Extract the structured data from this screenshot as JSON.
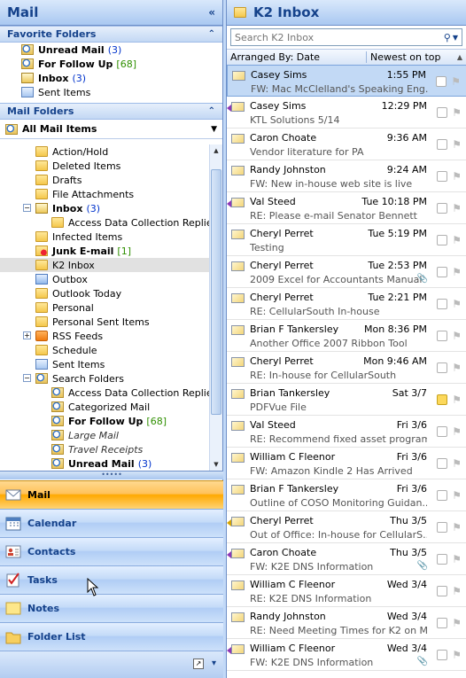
{
  "left": {
    "title": "Mail",
    "favorites": {
      "header": "Favorite Folders",
      "items": [
        {
          "label": "Unread Mail",
          "count": "(3)",
          "type": "search",
          "bold": true
        },
        {
          "label": "For Follow Up",
          "count": "[68]",
          "type": "search",
          "bold": true
        },
        {
          "label": "Inbox",
          "count": "(3)",
          "type": "inbox",
          "bold": true
        },
        {
          "label": "Sent Items",
          "count": "",
          "type": "sent",
          "bold": false
        }
      ]
    },
    "mail_folders": {
      "header": "Mail Folders",
      "all_items": "All Mail Items",
      "tree": [
        {
          "label": "Action/Hold",
          "indent": 40,
          "icon": "folder"
        },
        {
          "label": "Deleted Items",
          "indent": 40,
          "icon": "folder"
        },
        {
          "label": "Drafts",
          "indent": 40,
          "icon": "folder"
        },
        {
          "label": "File Attachments",
          "indent": 40,
          "icon": "folder"
        },
        {
          "label": "Inbox",
          "indent": 40,
          "icon": "inbox",
          "bold": true,
          "count": "(3)",
          "countColor": "blue",
          "exp": "−"
        },
        {
          "label": "Access Data Collection Replies",
          "indent": 58,
          "icon": "folder"
        },
        {
          "label": "Infected Items",
          "indent": 40,
          "icon": "folder"
        },
        {
          "label": "Junk E-mail",
          "indent": 40,
          "icon": "junk",
          "bold": true,
          "count": "[1]",
          "countColor": "green"
        },
        {
          "label": "K2 Inbox",
          "indent": 40,
          "icon": "folder",
          "sel": true
        },
        {
          "label": "Outbox",
          "indent": 40,
          "icon": "out"
        },
        {
          "label": "Outlook Today",
          "indent": 40,
          "icon": "folder"
        },
        {
          "label": "Personal",
          "indent": 40,
          "icon": "folder"
        },
        {
          "label": "Personal Sent Items",
          "indent": 40,
          "icon": "folder"
        },
        {
          "label": "RSS Feeds",
          "indent": 40,
          "icon": "rss",
          "exp": "+"
        },
        {
          "label": "Schedule",
          "indent": 40,
          "icon": "folder"
        },
        {
          "label": "Sent Items",
          "indent": 40,
          "icon": "sent"
        },
        {
          "label": "Search Folders",
          "indent": 40,
          "icon": "search",
          "exp": "−"
        },
        {
          "label": "Access Data Collection Replies",
          "indent": 58,
          "icon": "search"
        },
        {
          "label": "Categorized Mail",
          "indent": 58,
          "icon": "search"
        },
        {
          "label": "For Follow Up",
          "indent": 58,
          "icon": "search",
          "bold": true,
          "count": "[68]",
          "countColor": "green"
        },
        {
          "label": "Large Mail",
          "indent": 58,
          "icon": "search",
          "italic": true
        },
        {
          "label": "Travel Receipts",
          "indent": 58,
          "icon": "search",
          "italic": true
        },
        {
          "label": "Unread Mail",
          "indent": 58,
          "icon": "search",
          "bold": true,
          "count": "(3)",
          "countColor": "blue"
        }
      ]
    },
    "nav": [
      {
        "label": "Mail",
        "active": true,
        "icon": "mail"
      },
      {
        "label": "Calendar",
        "active": false,
        "icon": "calendar"
      },
      {
        "label": "Contacts",
        "active": false,
        "icon": "contacts"
      },
      {
        "label": "Tasks",
        "active": false,
        "icon": "tasks"
      },
      {
        "label": "Notes",
        "active": false,
        "icon": "notes"
      },
      {
        "label": "Folder List",
        "active": false,
        "icon": "folderlist"
      }
    ]
  },
  "right": {
    "title": "K2 Inbox",
    "search_placeholder": "Search K2 Inbox",
    "arranged_by": "Arranged By: Date",
    "order": "Newest on top",
    "messages": [
      {
        "from": "Casey Sims",
        "when": "1:55 PM",
        "subject": "FW: Mac McClelland's Speaking Eng...",
        "sel": true,
        "env": "",
        "cat": ""
      },
      {
        "from": "Casey Sims",
        "when": "12:29 PM",
        "subject": "KTL Solutions 5/14",
        "env": "reply",
        "cat": ""
      },
      {
        "from": "Caron Choate",
        "when": "9:36 AM",
        "subject": "Vendor literature for PA",
        "env": "",
        "cat": ""
      },
      {
        "from": "Randy Johnston",
        "when": "9:24 AM",
        "subject": "FW: New in-house web site is live",
        "env": "",
        "cat": ""
      },
      {
        "from": "Val Steed",
        "when": "Tue 10:18 PM",
        "subject": "RE: Please e-mail Senator Bennett",
        "env": "reply",
        "cat": ""
      },
      {
        "from": "Cheryl Perret",
        "when": "Tue 5:19 PM",
        "subject": "Testing",
        "env": "",
        "cat": ""
      },
      {
        "from": "Cheryl Perret",
        "when": "Tue 2:53 PM",
        "subject": "2009 Excel for Accountants Manual",
        "env": "",
        "clip": true,
        "cat": ""
      },
      {
        "from": "Cheryl Perret",
        "when": "Tue 2:21 PM",
        "subject": "RE: CellularSouth In-house",
        "env": "",
        "cat": ""
      },
      {
        "from": "Brian F Tankersley",
        "when": "Mon 8:36 PM",
        "subject": "Another Office 2007 Ribbon Tool",
        "env": "",
        "cat": ""
      },
      {
        "from": "Cheryl Perret",
        "when": "Mon 9:46 AM",
        "subject": "RE: In-house for CellularSouth",
        "env": "",
        "cat": ""
      },
      {
        "from": "Brian Tankersley",
        "when": "Sat 3/7",
        "subject": "PDFVue File",
        "env": "",
        "cat": "yellow"
      },
      {
        "from": "Val Steed",
        "when": "Fri 3/6",
        "subject": "RE: Recommend fixed asset program",
        "env": "",
        "cat": ""
      },
      {
        "from": "William C Fleenor",
        "when": "Fri 3/6",
        "subject": "FW: Amazon Kindle 2 Has Arrived",
        "env": "",
        "cat": ""
      },
      {
        "from": "Brian F Tankersley",
        "when": "Fri 3/6",
        "subject": "Outline of COSO Monitoring Guidan...",
        "env": "",
        "cat": ""
      },
      {
        "from": "Cheryl Perret",
        "when": "Thu 3/5",
        "subject": "Out of Office: In-house for CellularS...",
        "env": "fwd2",
        "cat": ""
      },
      {
        "from": "Caron Choate",
        "when": "Thu 3/5",
        "subject": "FW: K2E DNS Information",
        "env": "reply",
        "clip": true,
        "cat": ""
      },
      {
        "from": "William C Fleenor",
        "when": "Wed 3/4",
        "subject": "RE: K2E DNS Information",
        "env": "",
        "cat": ""
      },
      {
        "from": "Randy Johnston",
        "when": "Wed 3/4",
        "subject": "RE: Need Meeting Times for K2 on M...",
        "env": "",
        "cat": ""
      },
      {
        "from": "William C Fleenor",
        "when": "Wed 3/4",
        "subject": "FW: K2E DNS Information",
        "env": "reply",
        "clip": true,
        "cat": ""
      }
    ]
  }
}
